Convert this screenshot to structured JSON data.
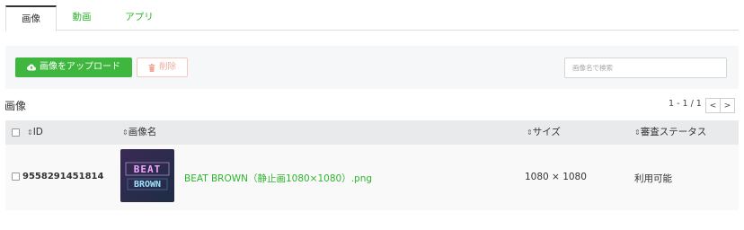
{
  "tabs": [
    {
      "label": "画像",
      "active": true
    },
    {
      "label": "動画",
      "active": false
    },
    {
      "label": "アプリ",
      "active": false
    }
  ],
  "toolbar": {
    "upload_label": "画像をアップロード",
    "delete_label": "削除",
    "search_placeholder": "画像名で検索"
  },
  "section": {
    "title": "画像"
  },
  "pagination": {
    "text": "1 - 1 / 1",
    "prev": "<",
    "next": ">"
  },
  "table": {
    "headers": {
      "id": "ID",
      "name": "画像名",
      "size": "サイズ",
      "status": "審査ステータス"
    },
    "rows": [
      {
        "id": "9558291451814",
        "thumbnail_text_top": "BEAT",
        "thumbnail_text_bottom": "BROWN",
        "name": "BEAT BROWN（静止画1080×1080）.png",
        "size": "1080 × 1080",
        "status": "利用可能"
      }
    ]
  },
  "colors": {
    "accent_green": "#3fb73f",
    "link_green": "#2fb52f",
    "delete_pink": "#f0a99a"
  },
  "icons": {
    "upload": "cloud-upload-icon",
    "delete": "trash-icon",
    "sort": "sort-icon"
  }
}
